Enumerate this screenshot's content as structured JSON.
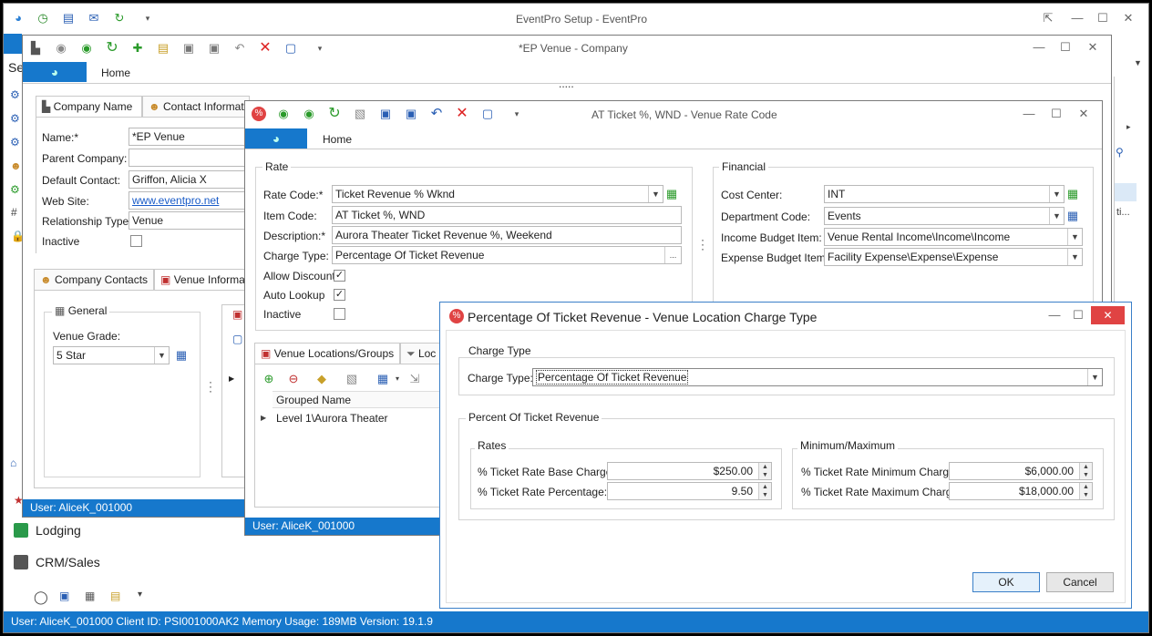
{
  "main": {
    "title": "EventPro Setup - EventPro",
    "status": "User: AliceK_001000   Client ID: PSI001000AK2   Memory Usage: 189MB   Version: 19.1.9",
    "left_stub": "Se",
    "nav": {
      "lodging": "Lodging",
      "crm": "CRM/Sales"
    }
  },
  "company_window": {
    "title": "*EP Venue - Company",
    "ribbon_tab": "Home",
    "tabs": [
      "Company Name",
      "Contact Informati"
    ],
    "fields": {
      "name_label": "Name:*",
      "name_value": "*EP Venue",
      "parent_label": "Parent Company:",
      "parent_value": "",
      "contact_label": "Default Contact:",
      "contact_value": "Griffon, Alicia X",
      "web_label": "Web Site:",
      "web_value": "www.eventpro.net",
      "rel_label": "Relationship Type:",
      "rel_value": "Venue",
      "inactive_label": "Inactive"
    },
    "lower_tabs": [
      "Company Contacts",
      "Venue Informa"
    ],
    "general_title": "General",
    "grade_label": "Venue Grade:",
    "grade_value": "5 Star",
    "status": "User: AliceK_001000",
    "dots": "....."
  },
  "rate_window": {
    "title": "AT Ticket %, WND - Venue Rate Code",
    "ribbon_tab": "Home",
    "rate_group": "Rate",
    "rate_code_label": "Rate Code:*",
    "rate_code_value": "Ticket Revenue % Wknd",
    "item_code_label": "Item Code:",
    "item_code_value": "AT Ticket %, WND",
    "desc_label": "Description:*",
    "desc_value": "Aurora Theater Ticket Revenue %, Weekend",
    "charge_label": "Charge Type:",
    "charge_value": "Percentage Of Ticket Revenue",
    "allow_discount": "Allow Discount",
    "auto_lookup": "Auto Lookup",
    "inactive": "Inactive",
    "financial_group": "Financial",
    "cost_center_label": "Cost Center:",
    "cost_center_value": "INT",
    "dept_label": "Department Code:",
    "dept_value": "Events",
    "income_label": "Income Budget Item:",
    "income_value": "Venue Rental Income\\Income\\Income",
    "expense_label": "Expense Budget Item:",
    "expense_value": "Facility Expense\\Expense\\Expense",
    "tabs": [
      "Venue Locations/Groups",
      "Loc"
    ],
    "grid_header": "Grouped Name",
    "grid_row": "Level 1\\Aurora Theater",
    "status": "User: AliceK_001000",
    "ellipsis": "..."
  },
  "dialog": {
    "title": "Percentage Of Ticket Revenue - Venue Location Charge Type",
    "charge_group": "Charge Type",
    "charge_label": "Charge Type:",
    "charge_value": "Percentage Of Ticket Revenue",
    "percent_group": "Percent Of Ticket Revenue",
    "rates_group": "Rates",
    "base_label": "% Ticket Rate Base Charge:",
    "base_value": "$250.00",
    "pct_label": "% Ticket Rate Percentage:",
    "pct_value": "9.50",
    "minmax_group": "Minimum/Maximum",
    "min_label": "% Ticket Rate Minimum Charge:",
    "min_value": "$6,000.00",
    "max_label": "% Ticket Rate Maximum Charge:",
    "max_value": "$18,000.00",
    "ok": "OK",
    "cancel": "Cancel"
  },
  "colors": {
    "accent": "#1678cc",
    "close_red": "#e04343",
    "dialog_icon": "#e04343"
  }
}
